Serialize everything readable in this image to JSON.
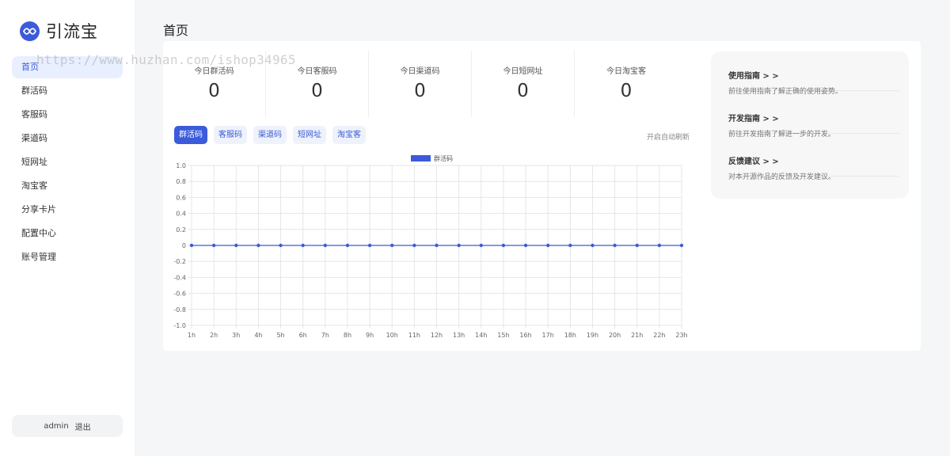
{
  "app": {
    "name": "引流宝"
  },
  "watermark": "https://www.huzhan.com/ishop34965",
  "sidebar": {
    "items": [
      {
        "label": "首页",
        "active": true
      },
      {
        "label": "群活码"
      },
      {
        "label": "客服码"
      },
      {
        "label": "渠道码"
      },
      {
        "label": "短网址"
      },
      {
        "label": "淘宝客"
      },
      {
        "label": "分享卡片"
      },
      {
        "label": "配置中心"
      },
      {
        "label": "账号管理"
      }
    ],
    "user": {
      "name": "admin",
      "logout_label": "退出"
    }
  },
  "page": {
    "title": "首页"
  },
  "stats": [
    {
      "label": "今日群活码",
      "value": "0"
    },
    {
      "label": "今日客服码",
      "value": "0"
    },
    {
      "label": "今日渠道码",
      "value": "0"
    },
    {
      "label": "今日短网址",
      "value": "0"
    },
    {
      "label": "今日淘宝客",
      "value": "0"
    }
  ],
  "tabs": [
    {
      "label": "群活码",
      "active": true
    },
    {
      "label": "客服码"
    },
    {
      "label": "渠道码"
    },
    {
      "label": "短网址"
    },
    {
      "label": "淘宝客"
    }
  ],
  "auto_refresh_label": "开启自动刷新",
  "guide": [
    {
      "title": "使用指南 > >",
      "desc": "前往使用指南了解正确的使用姿势。"
    },
    {
      "title": "开发指南 > >",
      "desc": "前往开发指南了解进一步的开发。"
    },
    {
      "title": "反馈建议 > >",
      "desc": "对本开源作品的反馈及开发建议。"
    }
  ],
  "colors": {
    "accent": "#3b5bdb",
    "series": "#3b5bdb"
  },
  "chart_data": {
    "type": "line",
    "x": [
      "1h",
      "2h",
      "3h",
      "4h",
      "5h",
      "6h",
      "7h",
      "8h",
      "9h",
      "10h",
      "11h",
      "12h",
      "13h",
      "14h",
      "15h",
      "16h",
      "17h",
      "18h",
      "19h",
      "20h",
      "21h",
      "22h",
      "23h"
    ],
    "series": [
      {
        "name": "群活码",
        "values": [
          0,
          0,
          0,
          0,
          0,
          0,
          0,
          0,
          0,
          0,
          0,
          0,
          0,
          0,
          0,
          0,
          0,
          0,
          0,
          0,
          0,
          0,
          0
        ]
      }
    ],
    "y_ticks": [
      "1.0",
      "0.8",
      "0.6",
      "0.4",
      "0.2",
      "0",
      "-0.2",
      "-0.4",
      "-0.6",
      "-0.8",
      "-1.0"
    ],
    "ylim": [
      -1,
      1
    ],
    "grid": true,
    "legend": "top"
  }
}
